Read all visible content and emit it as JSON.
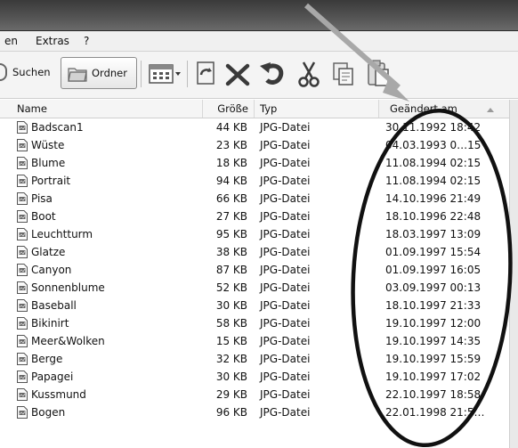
{
  "menu": {
    "items": [
      "en",
      "Extras",
      "?"
    ]
  },
  "toolbar": {
    "search_label": "Suchen",
    "folders_label": "Ordner"
  },
  "columns": {
    "name": "Name",
    "size": "Größe",
    "type": "Typ",
    "date": "Geändert am"
  },
  "sort": {
    "column": "date",
    "direction": "ascending"
  },
  "files": [
    {
      "name": "Badscan1",
      "size": "44 KB",
      "type": "JPG-Datei",
      "date": "30.11.1992 18:42"
    },
    {
      "name": "Wüste",
      "size": "23 KB",
      "type": "JPG-Datei",
      "date": "04.03.1993 0…15"
    },
    {
      "name": "Blume",
      "size": "18 KB",
      "type": "JPG-Datei",
      "date": "11.08.1994 02:15"
    },
    {
      "name": "Portrait",
      "size": "94 KB",
      "type": "JPG-Datei",
      "date": "11.08.1994 02:15"
    },
    {
      "name": "Pisa",
      "size": "66 KB",
      "type": "JPG-Datei",
      "date": "14.10.1996 21:49"
    },
    {
      "name": "Boot",
      "size": "27 KB",
      "type": "JPG-Datei",
      "date": "18.10.1996 22:48"
    },
    {
      "name": "Leuchtturm",
      "size": "95 KB",
      "type": "JPG-Datei",
      "date": "18.03.1997 13:09"
    },
    {
      "name": "Glatze",
      "size": "38 KB",
      "type": "JPG-Datei",
      "date": "01.09.1997 15:54"
    },
    {
      "name": "Canyon",
      "size": "87 KB",
      "type": "JPG-Datei",
      "date": "01.09.1997 16:05"
    },
    {
      "name": "Sonnenblume",
      "size": "52 KB",
      "type": "JPG-Datei",
      "date": "03.09.1997 00:13"
    },
    {
      "name": "Baseball",
      "size": "30 KB",
      "type": "JPG-Datei",
      "date": "18.10.1997 21:33"
    },
    {
      "name": "Bikinirt",
      "size": "58 KB",
      "type": "JPG-Datei",
      "date": "19.10.1997 12:00"
    },
    {
      "name": "Meer&Wolken",
      "size": "15 KB",
      "type": "JPG-Datei",
      "date": "19.10.1997 14:35"
    },
    {
      "name": "Berge",
      "size": "32 KB",
      "type": "JPG-Datei",
      "date": "19.10.1997 15:59"
    },
    {
      "name": "Papagei",
      "size": "30 KB",
      "type": "JPG-Datei",
      "date": "19.10.1997 17:02"
    },
    {
      "name": "Kussmund",
      "size": "29 KB",
      "type": "JPG-Datei",
      "date": "22.10.1997 18:58"
    },
    {
      "name": "Bogen",
      "size": "96 KB",
      "type": "JPG-Datei",
      "date": "22.01.1998 21:5…"
    }
  ],
  "icons": {
    "toolbar": [
      "search-icon",
      "folder-icon",
      "views-icon",
      "move-icon",
      "delete-icon",
      "undo-icon",
      "cut-icon",
      "copy-icon",
      "paste-icon"
    ],
    "file": "jpg-file-icon",
    "sort": "sort-ascending-icon"
  },
  "annotation": {
    "ellipse_color": "#111111",
    "arrow_color": "#a8a8a8"
  }
}
